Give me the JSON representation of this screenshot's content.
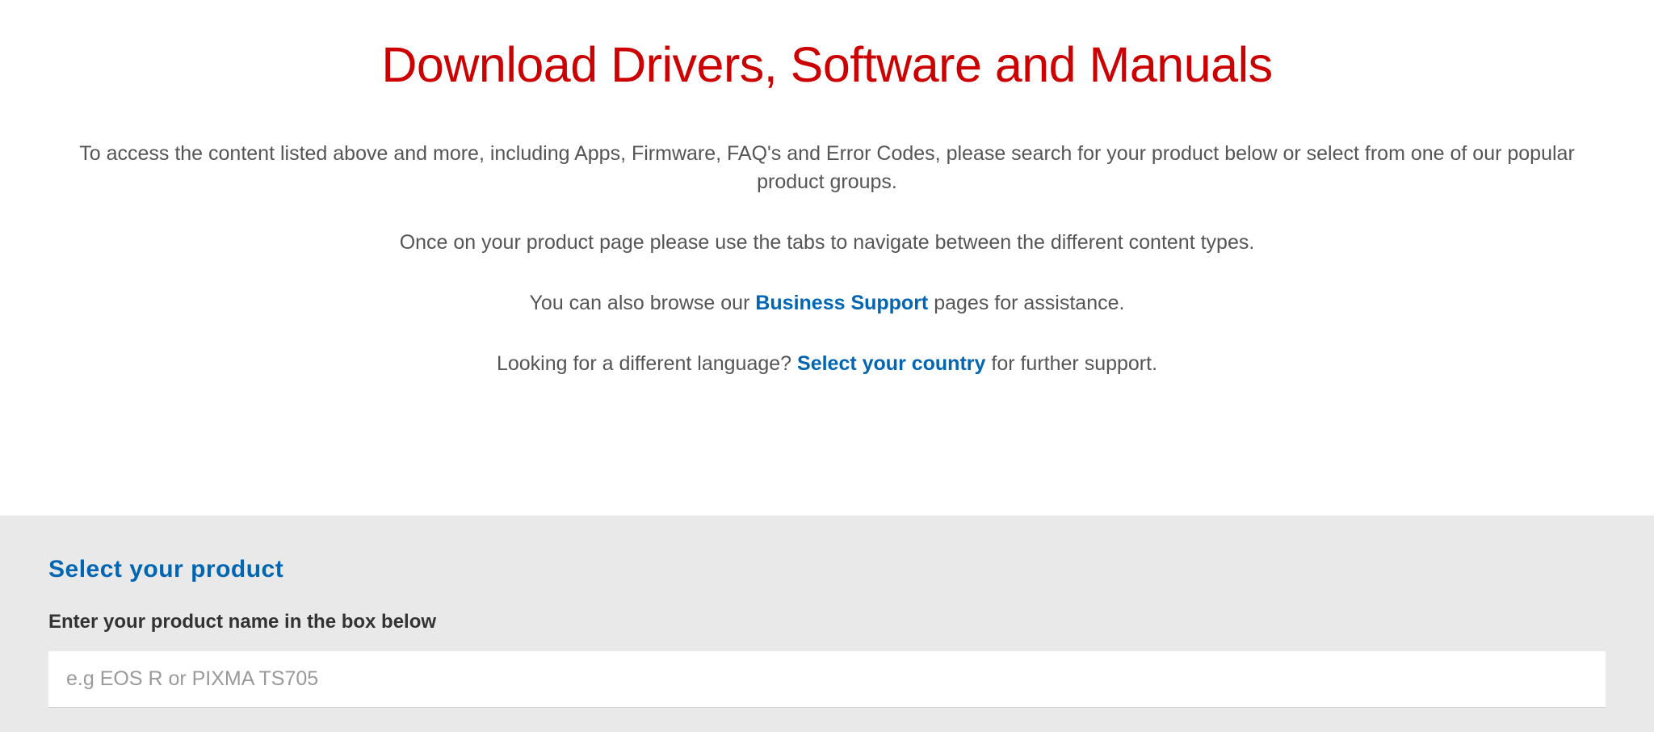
{
  "header": {
    "title": "Download Drivers, Software and Manuals",
    "para1": "To access the content listed above and more, including Apps, Firmware, FAQ's and Error Codes, please search for your product below or select from one of our popular product groups.",
    "para2": "Once on your product page please use the tabs to navigate between the different content types.",
    "para3_prefix": "You can also browse our ",
    "para3_link": "Business Support",
    "para3_suffix": " pages for assistance.",
    "para4_prefix": "Looking for a different language? ",
    "para4_link": "Select your country",
    "para4_suffix": " for further support."
  },
  "search_section": {
    "heading": "Select your product",
    "label": "Enter your product name in the box below",
    "placeholder": "e.g EOS R or PIXMA TS705"
  }
}
